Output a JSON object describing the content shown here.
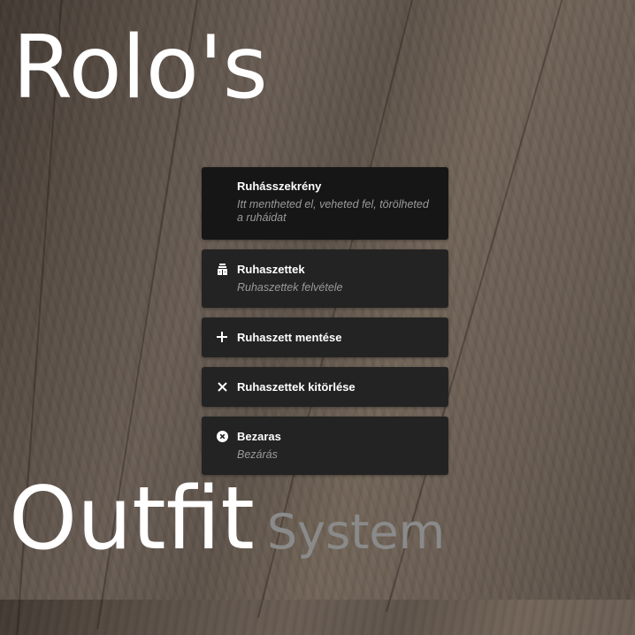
{
  "title": {
    "top": "Rolo's",
    "bottom_main": "Outfit",
    "bottom_sub": "System"
  },
  "menu": {
    "header": {
      "title": "Ruhásszekrény",
      "description": "Itt mentheted el, veheted fel, törölheted a ruháidat"
    },
    "items": [
      {
        "label": "Ruhaszettek",
        "description": "Ruhaszettek felvétele",
        "icon": "wardrobe-icon"
      },
      {
        "label": "Ruhaszett mentése",
        "icon": "plus-icon"
      },
      {
        "label": "Ruhaszettek kitörlése",
        "icon": "close-icon"
      },
      {
        "label": "Bezaras",
        "description": "Bezárás",
        "icon": "circle-x-icon"
      }
    ]
  },
  "colors": {
    "panel": "#232323",
    "header": "#161616",
    "text": "#ffffff",
    "muted": "#9a9a9a",
    "system_text": "#8a8a8a"
  }
}
